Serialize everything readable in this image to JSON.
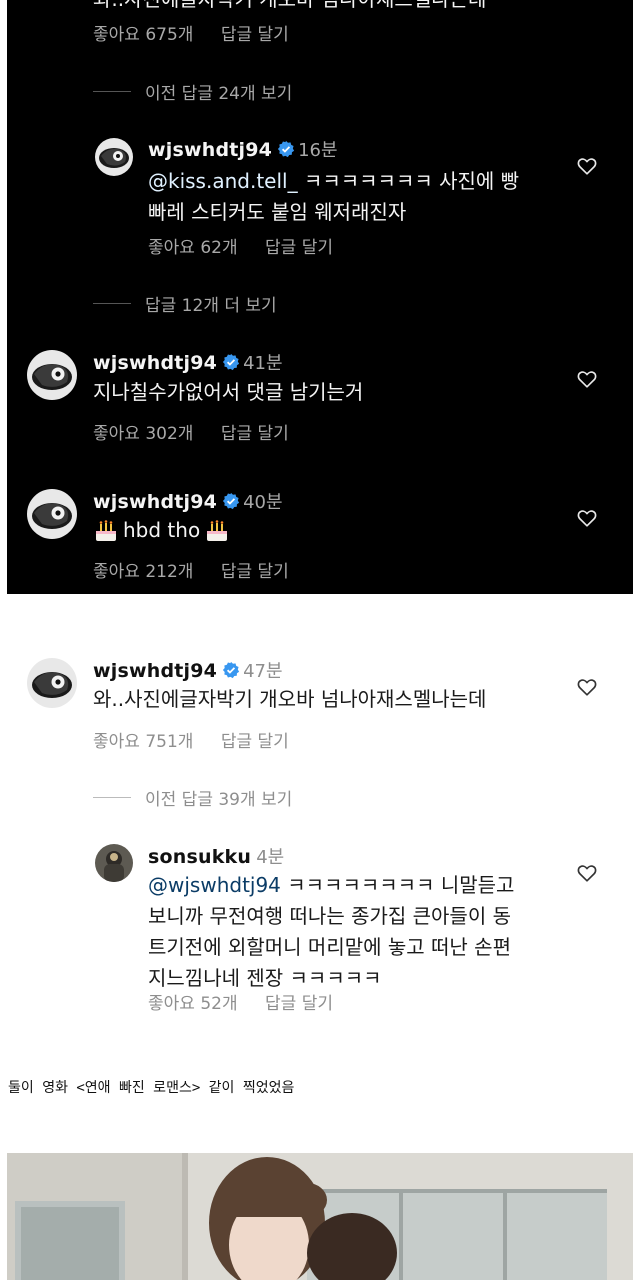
{
  "dark_section": {
    "top_comment": {
      "text_cut": "와..사진에글자박기 개오바 넘나아재스멜나는데",
      "likes": "좋아요 675개",
      "reply": "답글 달기"
    },
    "view_prev_replies": "이전 답글 24개 보기",
    "reply1": {
      "username": "wjswhdtj94",
      "time": "16분",
      "mention": "@kiss.and.tell_",
      "text_line1": " ㅋㅋㅋㅋㅋㅋㅋ 사진에 빵",
      "text_line2": "빠레 스티커도 붙임 웨저래진자",
      "likes": "좋아요 62개",
      "reply": "답글 달기"
    },
    "view_more_replies": "답글 12개 더 보기",
    "comment2": {
      "username": "wjswhdtj94",
      "time": "41분",
      "text": "지나칠수가없어서 댓글 남기는거",
      "likes": "좋아요 302개",
      "reply": "답글 달기"
    },
    "comment3": {
      "username": "wjswhdtj94",
      "time": "40분",
      "text": "hbd tho",
      "likes": "좋아요 212개",
      "reply": "답글 달기"
    }
  },
  "light_section": {
    "comment": {
      "username": "wjswhdtj94",
      "time": "47분",
      "text": "와..사진에글자박기 개오바 넘나아재스멜나는데",
      "likes": "좋아요 751개",
      "reply": "답글 달기"
    },
    "view_prev_replies": "이전 답글 39개 보기",
    "reply": {
      "username": "sonsukku",
      "time": "4분",
      "mention": "@wjswhdtj94",
      "line1": " ㅋㅋㅋㅋㅋㅋㅋㅋ 니말듣고",
      "line2": "보니까 무전여행 떠나는 종가집 큰아들이 동",
      "line3": "트기전에 외할머니 머리맡에 놓고 떠난 손편",
      "line4": "지느낌나네 젠장 ㅋㅋㅋㅋㅋ",
      "likes": "좋아요 52개",
      "reply": "답글 달기"
    }
  },
  "caption": "둘이 영화 <연애 빠진 로맨스> 같이 찍었었음",
  "colors": {
    "verified_blue": "#3897f0",
    "dark_bg": "#000000",
    "mention_blue": "#e0f1ff"
  },
  "icons": {
    "heart": "heart-outline-icon",
    "verified": "verified-badge-icon",
    "cake": "birthday-cake-emoji"
  }
}
